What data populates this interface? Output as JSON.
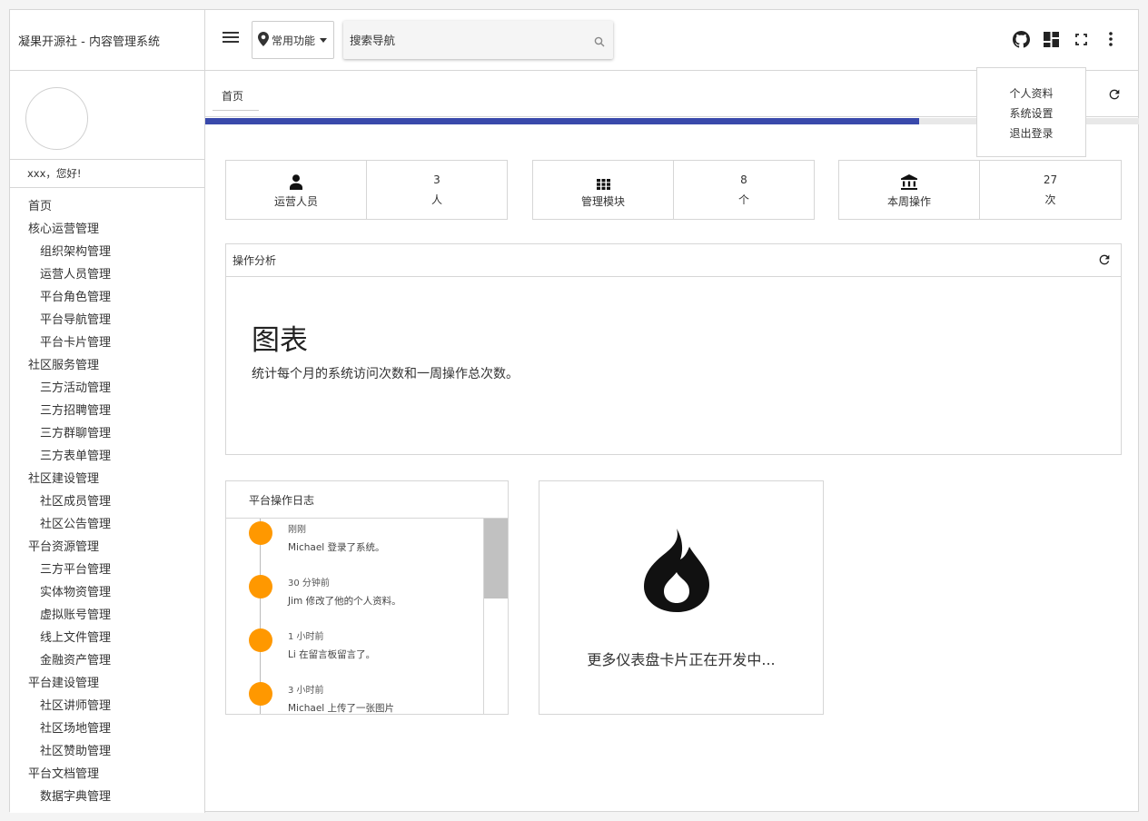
{
  "brand": "凝果开源社 - 内容管理系统",
  "greeting": "xxx，您好!",
  "nav": [
    {
      "label": "首页",
      "level": 1
    },
    {
      "label": "核心运营管理",
      "level": 1
    },
    {
      "label": "组织架构管理",
      "level": 2
    },
    {
      "label": "运营人员管理",
      "level": 2
    },
    {
      "label": "平台角色管理",
      "level": 2
    },
    {
      "label": "平台导航管理",
      "level": 2
    },
    {
      "label": "平台卡片管理",
      "level": 2
    },
    {
      "label": "社区服务管理",
      "level": 1
    },
    {
      "label": "三方活动管理",
      "level": 2
    },
    {
      "label": "三方招聘管理",
      "level": 2
    },
    {
      "label": "三方群聊管理",
      "level": 2
    },
    {
      "label": "三方表单管理",
      "level": 2
    },
    {
      "label": "社区建设管理",
      "level": 1
    },
    {
      "label": "社区成员管理",
      "level": 2
    },
    {
      "label": "社区公告管理",
      "level": 2
    },
    {
      "label": "平台资源管理",
      "level": 1
    },
    {
      "label": "三方平台管理",
      "level": 2
    },
    {
      "label": "实体物资管理",
      "level": 2
    },
    {
      "label": "虚拟账号管理",
      "level": 2
    },
    {
      "label": "线上文件管理",
      "level": 2
    },
    {
      "label": "金融资产管理",
      "level": 2
    },
    {
      "label": "平台建设管理",
      "level": 1
    },
    {
      "label": "社区讲师管理",
      "level": 2
    },
    {
      "label": "社区场地管理",
      "level": 2
    },
    {
      "label": "社区赞助管理",
      "level": 2
    },
    {
      "label": "平台文档管理",
      "level": 1
    },
    {
      "label": "数据字典管理",
      "level": 2
    }
  ],
  "topbar": {
    "common_functions": "常用功能",
    "search_placeholder": "搜索导航"
  },
  "user_menu": [
    "个人资料",
    "系统设置",
    "退出登录"
  ],
  "tab_home": "首页",
  "progress_percent": 76.5,
  "stats": [
    {
      "label": "运营人员",
      "value": "3",
      "unit": "人",
      "icon": "person-icon"
    },
    {
      "label": "管理模块",
      "value": "8",
      "unit": "个",
      "icon": "grid-icon"
    },
    {
      "label": "本周操作",
      "value": "27",
      "unit": "次",
      "icon": "bank-icon"
    }
  ],
  "analysis": {
    "header": "操作分析",
    "title": "图表",
    "description": "统计每个月的系统访问次数和一周操作总次数。"
  },
  "log": {
    "header": "平台操作日志",
    "entries": [
      {
        "time": "刚刚",
        "message": "Michael 登录了系统。"
      },
      {
        "time": "30 分钟前",
        "message": "Jim 修改了他的个人资料。"
      },
      {
        "time": "1 小时前",
        "message": "Li 在留言板留言了。"
      },
      {
        "time": "3 小时前",
        "message": "Michael 上传了一张图片"
      }
    ]
  },
  "dev_card": {
    "text": "更多仪表盘卡片正在开发中..."
  },
  "colors": {
    "accent": "#3949ab",
    "timeline_dot": "#ff9800"
  }
}
